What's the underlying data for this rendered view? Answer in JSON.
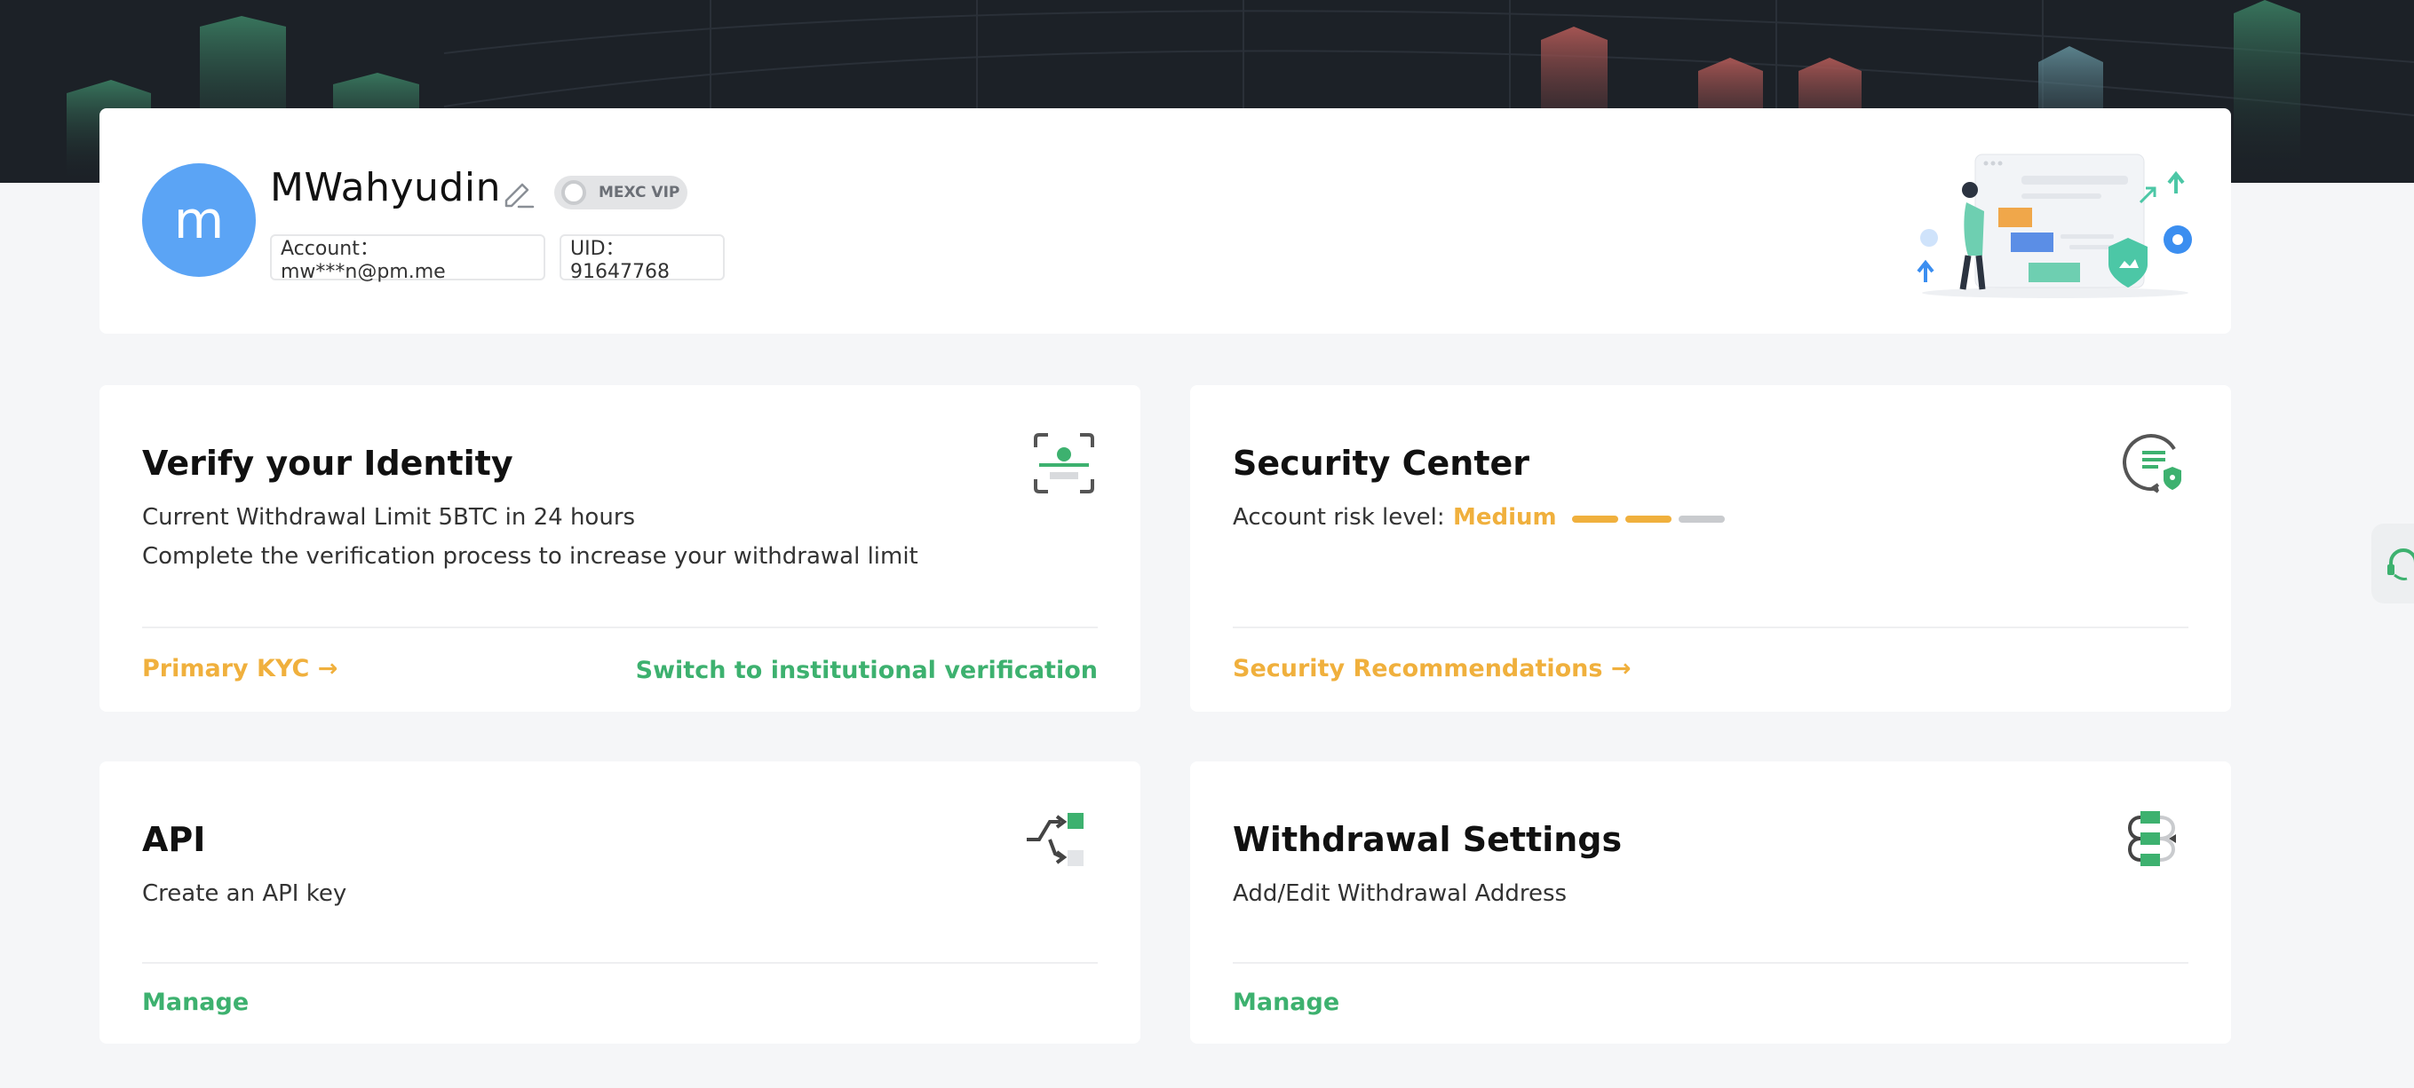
{
  "profile": {
    "avatar_letter": "m",
    "username": "MWahyudin",
    "vip_label": "MEXC VIP",
    "account": "Account： mw***n@pm.me",
    "uid": "UID： 91647768"
  },
  "cards": {
    "verify": {
      "title": "Verify your Identity",
      "line1": "Current Withdrawal Limit 5BTC in 24 hours",
      "line2": "Complete the verification process to increase your withdrawal limit",
      "primary_link": "Primary KYC →",
      "secondary_link": "Switch to institutional verification"
    },
    "security": {
      "title": "Security Center",
      "risk_label": "Account risk level:",
      "risk_value": "Medium",
      "risk_level": 2,
      "risk_max": 3,
      "link": "Security Recommendations →"
    },
    "api": {
      "title": "API",
      "text": "Create an API key",
      "link": "Manage"
    },
    "withdrawal": {
      "title": "Withdrawal Settings",
      "text": "Add/Edit Withdrawal Address",
      "link": "Manage"
    }
  },
  "colors": {
    "accent_orange": "#f0b03d",
    "accent_green": "#3db16f",
    "avatar_blue": "#5ba4f5",
    "banner_dark": "#1c2127"
  }
}
